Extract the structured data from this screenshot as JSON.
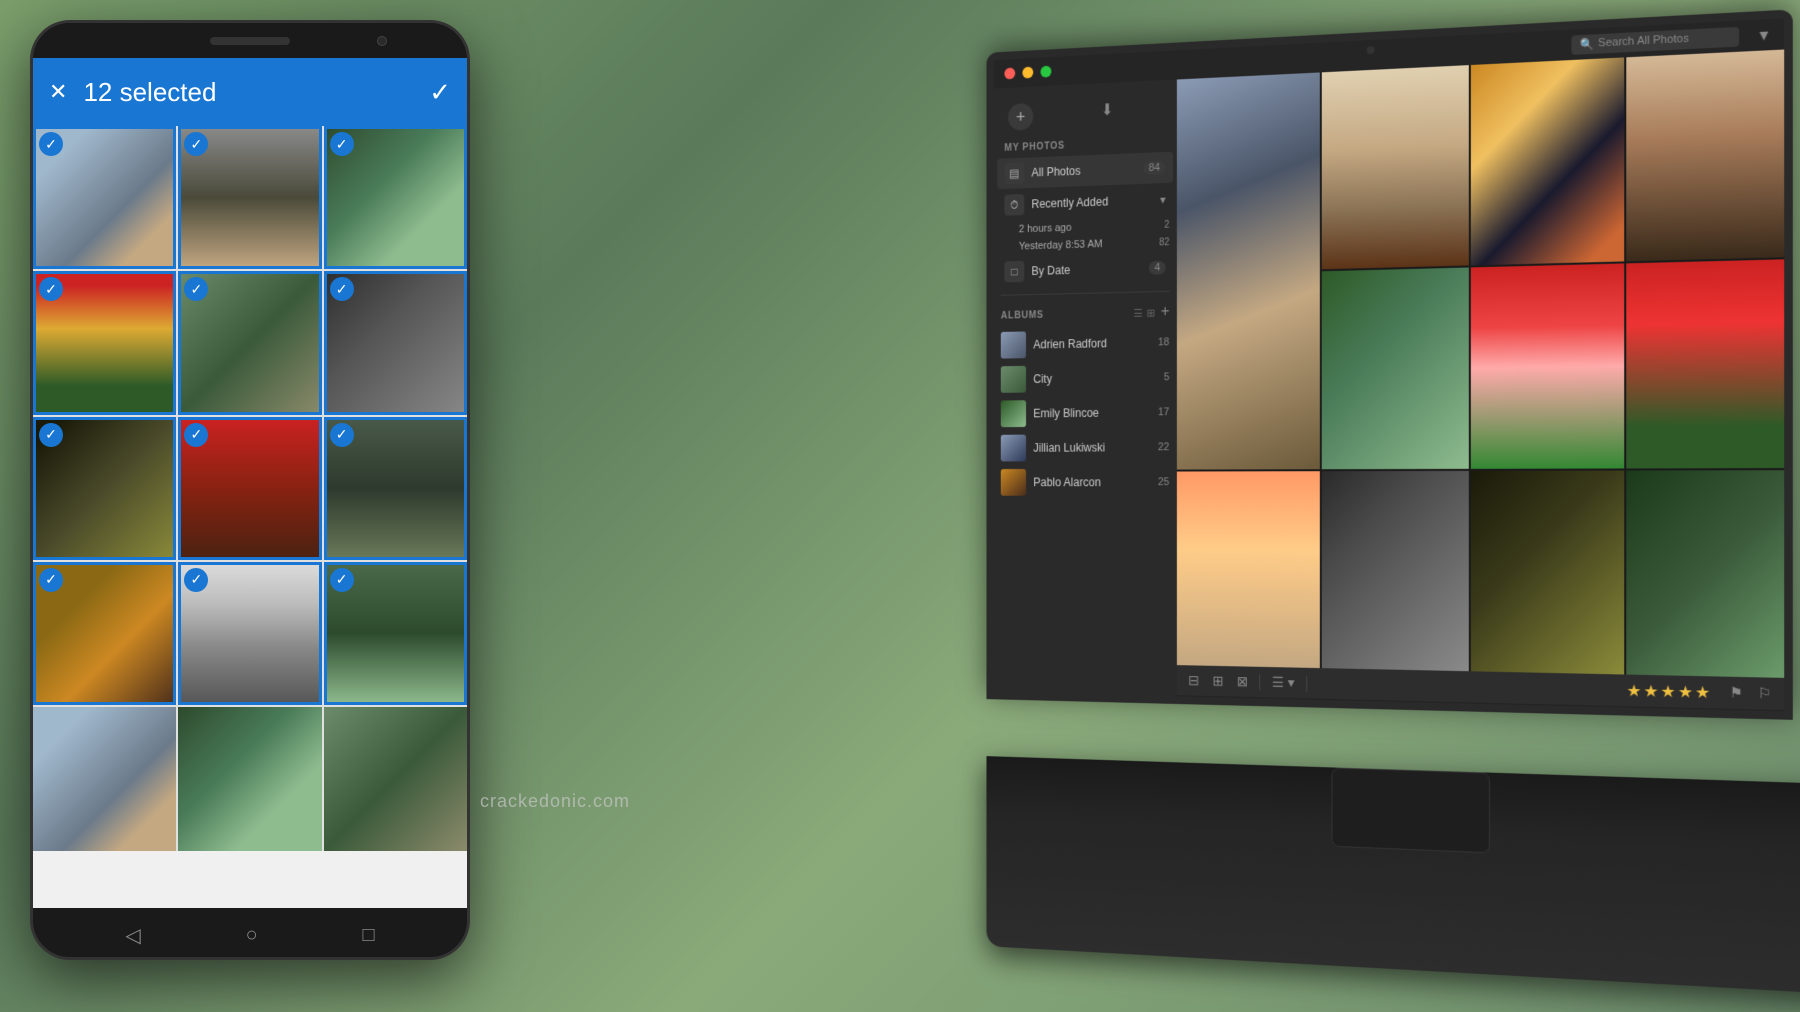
{
  "background": {
    "color1": "#7a9e6b",
    "color2": "#5a7a5a"
  },
  "phone": {
    "header": {
      "selected_count": "12 selected",
      "close_label": "✕",
      "check_label": "✓"
    },
    "grid_photos": [
      {
        "id": 1,
        "selected": true,
        "style": "p1"
      },
      {
        "id": 2,
        "selected": true,
        "style": "p2"
      },
      {
        "id": 3,
        "selected": true,
        "style": "p3"
      },
      {
        "id": 4,
        "selected": true,
        "style": "p4"
      },
      {
        "id": 5,
        "selected": true,
        "style": "p5"
      },
      {
        "id": 6,
        "selected": true,
        "style": "p6"
      },
      {
        "id": 7,
        "selected": true,
        "style": "p7"
      },
      {
        "id": 8,
        "selected": true,
        "style": "p8"
      },
      {
        "id": 9,
        "selected": true,
        "style": "p9"
      },
      {
        "id": 10,
        "selected": true,
        "style": "p10"
      },
      {
        "id": 11,
        "selected": true,
        "style": "p11"
      },
      {
        "id": 12,
        "selected": true,
        "style": "p12"
      },
      {
        "id": 13,
        "selected": false,
        "style": "p1"
      },
      {
        "id": 14,
        "selected": false,
        "style": "p3"
      },
      {
        "id": 15,
        "selected": false,
        "style": "p5"
      }
    ],
    "nav": {
      "back": "◁",
      "home": "○",
      "recent": "□"
    }
  },
  "laptop": {
    "titlebar": {
      "dots": [
        "red",
        "yellow",
        "green"
      ],
      "search_placeholder": "Search All Photos",
      "filter_icon": "▼"
    },
    "sidebar": {
      "my_photos_label": "MY PHOTOS",
      "new_btn": "+",
      "import_icon": "⬇",
      "all_photos": {
        "label": "All Photos",
        "count": "84",
        "icon": "▤"
      },
      "recently_added": {
        "label": "Recently Added",
        "icon": "🕐",
        "expand_icon": "▾",
        "subitems": [
          {
            "label": "2 hours ago",
            "count": "2"
          },
          {
            "label": "Yesterday 8:53 AM",
            "count": "82"
          }
        ]
      },
      "by_date": {
        "label": "By Date",
        "icon": "□",
        "count": "4"
      },
      "albums": {
        "label": "ALBUMS",
        "view_list": "☰",
        "view_grid": "⊞",
        "add_btn": "+",
        "items": [
          {
            "name": "Adrien Radford",
            "count": "18"
          },
          {
            "name": "City",
            "count": "5"
          },
          {
            "name": "Emily Blincoe",
            "count": "17"
          },
          {
            "name": "Jillian Lukiwski",
            "count": "22"
          },
          {
            "name": "Pablo Alarcon",
            "count": "25"
          }
        ]
      }
    },
    "toolbar": {
      "view_large": "⊟",
      "view_medium": "⊞",
      "view_small": "⊠",
      "sort_icon": "☰",
      "sort_arrow": "▾",
      "flag1": "⚑",
      "flag2": "⚐",
      "stars": [
        1,
        1,
        1,
        1,
        1
      ]
    }
  },
  "watermark": "crackedonic.com"
}
